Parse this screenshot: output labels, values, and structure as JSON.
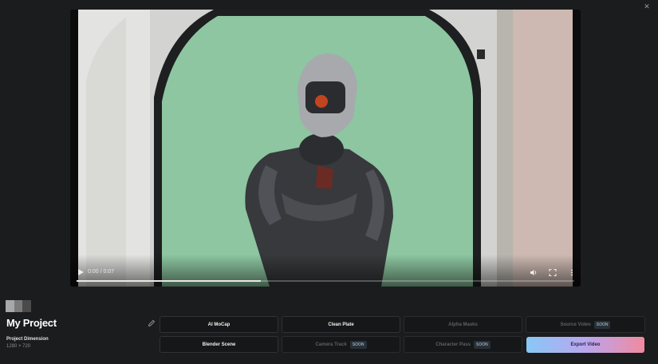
{
  "window": {
    "close_icon": "close-icon"
  },
  "player": {
    "time_display": "0:00 / 0:07",
    "progress_fraction": 0.37,
    "icons": [
      "play-icon",
      "volume-icon",
      "fullscreen-icon",
      "more-vertical-icon"
    ]
  },
  "project": {
    "title": "My Project",
    "dimension_label": "Project Dimension",
    "dimension_value": "1280 × 720",
    "thumb_colors": [
      "#a8a8a8",
      "#7a7a7a",
      "#4a4a4a"
    ]
  },
  "actions": {
    "ai_mocap": "AI MoCap",
    "clean_plate": "Clean Plate",
    "alpha_masks": "Alpha Masks",
    "source_video": "Source Video",
    "blender_scene": "Blender Scene",
    "camera_track": "Camera Track",
    "character_pass": "Character Pass",
    "export_video": "Export Video",
    "soon_badge": "SOON"
  },
  "colors": {
    "background": "#1b1c1e",
    "export_gradient": [
      "#88c8f6",
      "#b9a6ee",
      "#f08aa0"
    ]
  }
}
